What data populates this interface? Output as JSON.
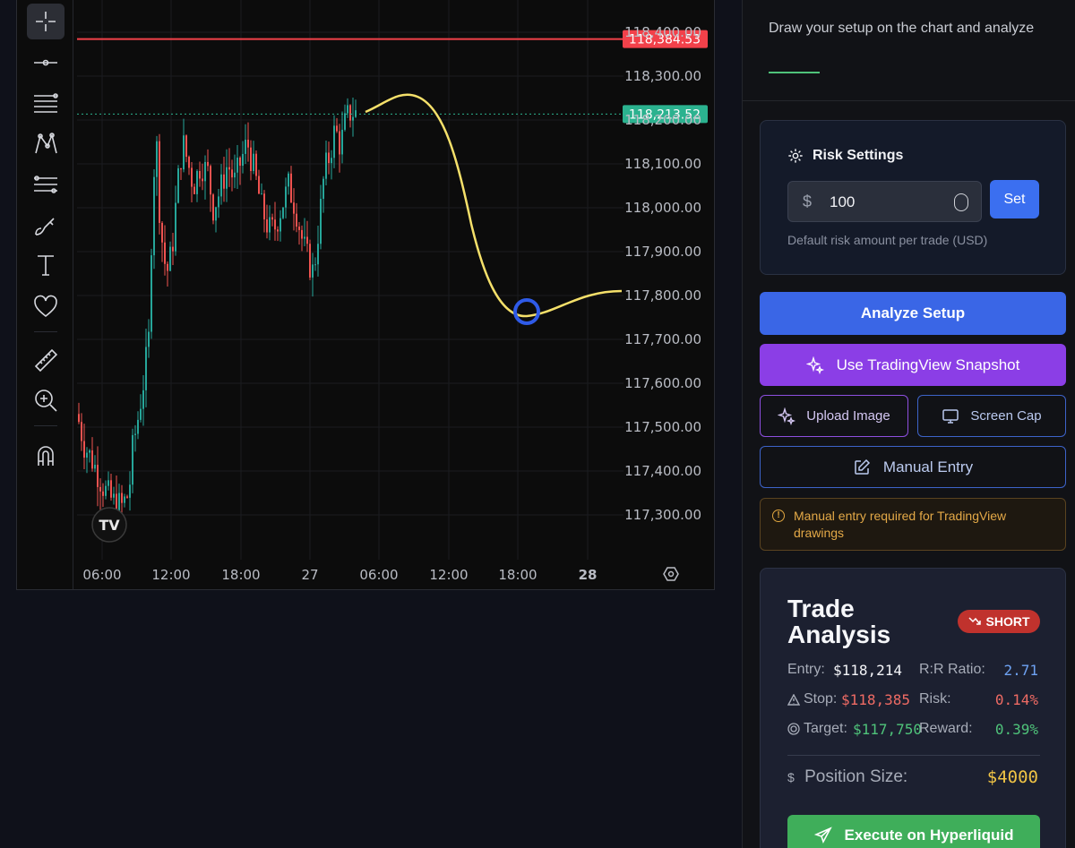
{
  "toolbar": {
    "tools": [
      "crosshair-icon",
      "horizontal-line-icon",
      "fib-lines-icon",
      "pattern-icon",
      "measure-lines-icon",
      "brush-icon",
      "text-icon",
      "heart-icon",
      "ruler-icon",
      "zoom-in-icon",
      "magnet-icon"
    ]
  },
  "chart": {
    "price_ticks": [
      "118,400.00",
      "118,300.00",
      "118,200.00",
      "118,100.00",
      "118,000.00",
      "117,900.00",
      "117,800.00",
      "117,700.00",
      "117,600.00",
      "117,500.00",
      "117,400.00",
      "117,300.00"
    ],
    "time_ticks": [
      "06:00",
      "12:00",
      "18:00",
      "27",
      "06:00",
      "12:00",
      "18:00",
      "28"
    ],
    "stop_price_label": "118,384.53",
    "current_price_label": "118,213.52",
    "colors": {
      "up": "#26a69a",
      "down": "#ef5350",
      "stop_line": "#f2414a",
      "current_line": "#2bb28f",
      "drawing": "#f5e06a",
      "marker": "#2f5be8"
    }
  },
  "chart_data": {
    "type": "candlestick",
    "ylim": [
      117250,
      118430
    ],
    "stop_price": 118384.53,
    "current_price": 118213.52,
    "drawn_projection": [
      [
        118213,
        0
      ],
      [
        118255,
        1
      ],
      [
        117790,
        3
      ],
      [
        117755,
        3.7
      ],
      [
        117810,
        5
      ]
    ]
  },
  "side": {
    "title": "Draw your setup on the chart and analyze",
    "risk": {
      "title": "Risk Settings",
      "currency_symbol": "$",
      "amount": "100",
      "set_label": "Set",
      "help": "Default risk amount per trade (USD)"
    },
    "buttons": {
      "analyze": "Analyze Setup",
      "tradingview": "Use TradingView Snapshot",
      "upload": "Upload Image",
      "screencap": "Screen Cap",
      "manual": "Manual Entry",
      "execute": "Execute on Hyperliquid"
    },
    "notice": "Manual entry required for TradingView drawings",
    "trade": {
      "title": "Trade Analysis",
      "direction": "SHORT",
      "entry_label": "Entry:",
      "entry_value": "$118,214",
      "rr_label": "R:R Ratio:",
      "rr_value": "2.71",
      "stop_label": "Stop:",
      "stop_value": "$118,385",
      "risk_label": "Risk:",
      "risk_value": "0.14%",
      "target_label": "Target:",
      "target_value": "$117,750",
      "reward_label": "Reward:",
      "reward_value": "0.39%",
      "position_label": "Position Size:",
      "position_value": "$4000"
    }
  }
}
